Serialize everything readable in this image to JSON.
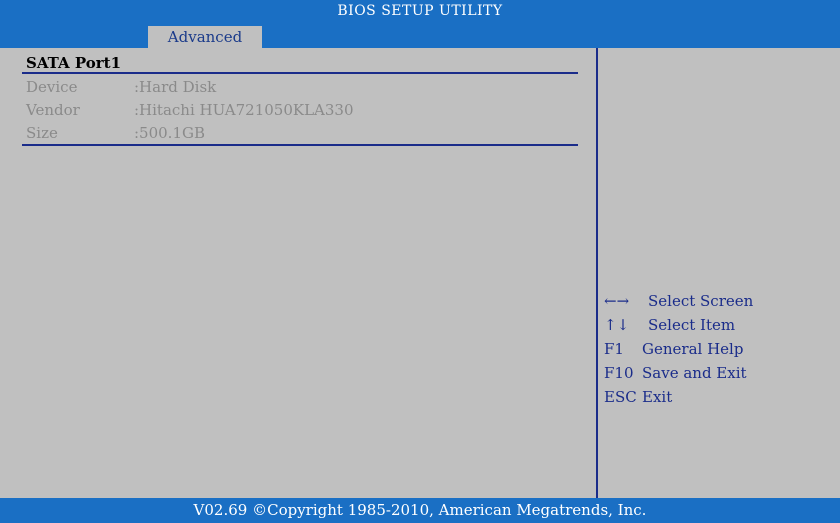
{
  "header": {
    "title": "BIOS SETUP UTILITY",
    "tab": "Advanced"
  },
  "main": {
    "section_title": "SATA Port1",
    "rows": [
      {
        "label": "Device",
        "value": ":Hard Disk"
      },
      {
        "label": "Vendor",
        "value": ":Hitachi HUA721050KLA330"
      },
      {
        "label": "Size",
        "value": ":500.1GB"
      }
    ]
  },
  "help": {
    "items": [
      {
        "key": "←→",
        "text": "Select Screen"
      },
      {
        "key": "↑↓",
        "text": "Select Item"
      },
      {
        "key": "F1",
        "text": "General Help"
      },
      {
        "key": "F10",
        "text": "Save and Exit"
      },
      {
        "key": "ESC",
        "text": "Exit"
      }
    ]
  },
  "footer": {
    "text": "V02.69 ©Copyright 1985-2010, American Megatrends, Inc."
  },
  "colors": {
    "bar_blue": "#1a6fc4",
    "panel_gray": "#c0c0c0",
    "text_navy": "#1a2c8a",
    "text_dim": "#8a8a8a"
  }
}
